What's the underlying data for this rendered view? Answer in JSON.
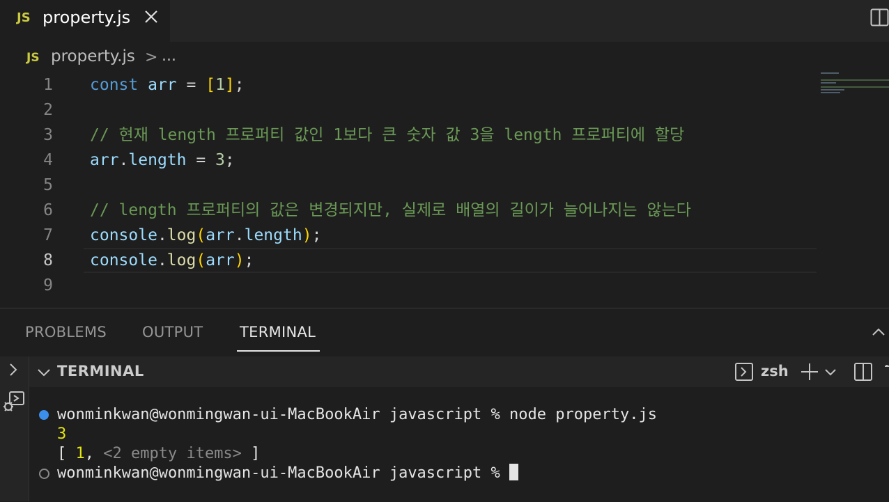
{
  "tab": {
    "badge": "JS",
    "title": "property.js"
  },
  "breadcrumb": {
    "badge": "JS",
    "file": "property.js",
    "separator": ">",
    "more": "..."
  },
  "editor": {
    "active_line": 8,
    "line_numbers": [
      "1",
      "2",
      "3",
      "4",
      "5",
      "6",
      "7",
      "8",
      "9"
    ],
    "lines": [
      {
        "t1": "const",
        "t2": " ",
        "t3": "arr",
        "t4": " = ",
        "t5": "[",
        "t6": "1",
        "t7": "]",
        "t8": ";"
      },
      {},
      {
        "comment": "// 현재 length 프로퍼티 값인 1보다 큰 숫자 값 3을 length 프로퍼티에 할당"
      },
      {
        "t1": "arr",
        "t2": ".",
        "t3": "length",
        "t4": " = ",
        "t5": "3",
        "t6": ";"
      },
      {},
      {
        "comment": "// length 프로퍼티의 값은 변경되지만, 실제로 배열의 길이가 늘어나지는 않는다"
      },
      {
        "t1": "console",
        "t2": ".",
        "t3": "log",
        "t4": "(",
        "t5": "arr",
        "t6": ".",
        "t7": "length",
        "t8": ")",
        "t9": ";"
      },
      {
        "t1": "console",
        "t2": ".",
        "t3": "log",
        "t4": "(",
        "t5": "arr",
        "t6": ")",
        "t7": ";"
      },
      {}
    ]
  },
  "panel": {
    "tabs": [
      "PROBLEMS",
      "OUTPUT",
      "TERMINAL"
    ],
    "active_tab": "TERMINAL"
  },
  "terminal": {
    "title": "TERMINAL",
    "shell": "zsh",
    "prompt": "wonminkwan@wonmingwan-ui-MacBookAir javascript % ",
    "command": "node property.js",
    "output_1": "3",
    "output_2_open": "[ ",
    "output_2_num": "1",
    "output_2_sep": ", ",
    "output_2_empty": "<2 empty items>",
    "output_2_close": " ]",
    "status_colors": {
      "completed": "#3b8eea",
      "pending": "#8a8a8a"
    }
  },
  "icons": [
    "close-icon",
    "split-editor-icon",
    "chevron-right-icon",
    "panel-collapse-icon",
    "chevron-down-icon",
    "debug-icon",
    "terminal-icon",
    "plus-icon",
    "dropdown-chevron-icon",
    "split-terminal-icon"
  ]
}
